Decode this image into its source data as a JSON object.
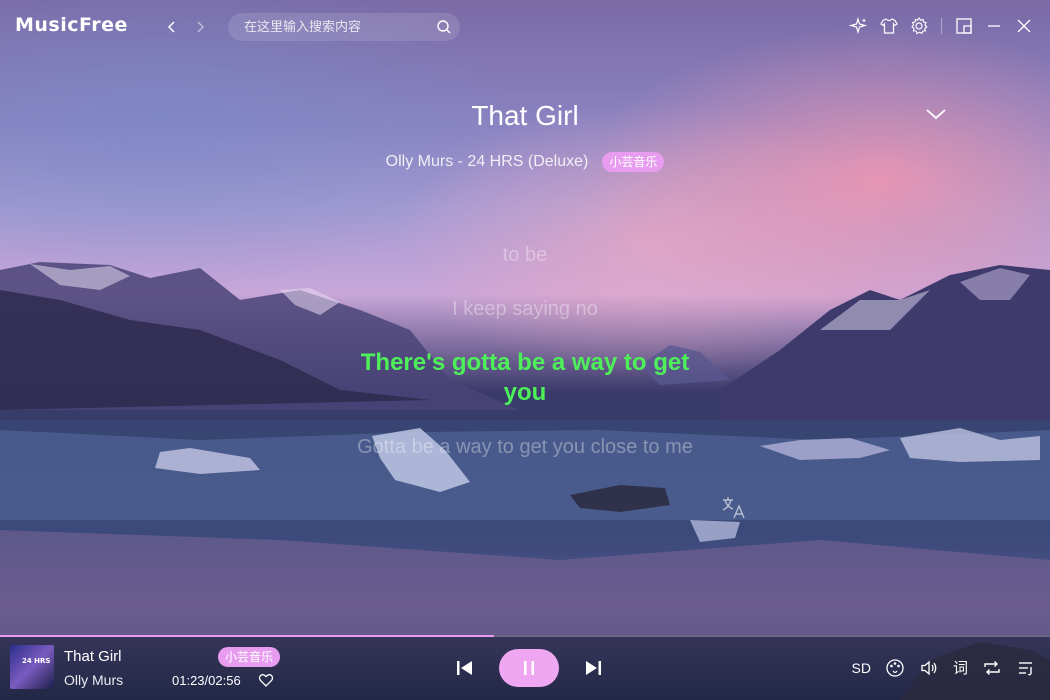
{
  "app": {
    "name": "MusicFree"
  },
  "search": {
    "placeholder": "在这里输入搜索内容"
  },
  "song": {
    "title": "That Girl",
    "subtitle": "Olly Murs - 24 HRS (Deluxe)",
    "source_tag": "小芸音乐"
  },
  "lyrics": {
    "lines": [
      "to be",
      "I keep saying no",
      "There's gotta be a way to get you",
      "Gotta be a way to get you close to me"
    ],
    "current_index": 2
  },
  "player": {
    "title": "That Girl",
    "artist": "Olly Murs",
    "source_tag": "小芸音乐",
    "time": "01:23/02:56",
    "progress": 0.47,
    "quality": "SD",
    "lyric_toggle": "词",
    "cover_text": "24 HRS"
  },
  "icons": {
    "titlebar": [
      "back-icon",
      "forward-icon",
      "search-icon",
      "sparkle-icon",
      "shirt-icon",
      "settings-icon",
      "mini-mode-icon",
      "minimize-icon",
      "close-icon"
    ],
    "player": [
      "prev-icon",
      "pause-icon",
      "next-icon",
      "heart-icon",
      "sound-effect-icon",
      "volume-icon",
      "repeat-icon",
      "playlist-icon"
    ]
  },
  "colors": {
    "accent": "#e79cf0",
    "current_lyric": "#4ef05a"
  }
}
